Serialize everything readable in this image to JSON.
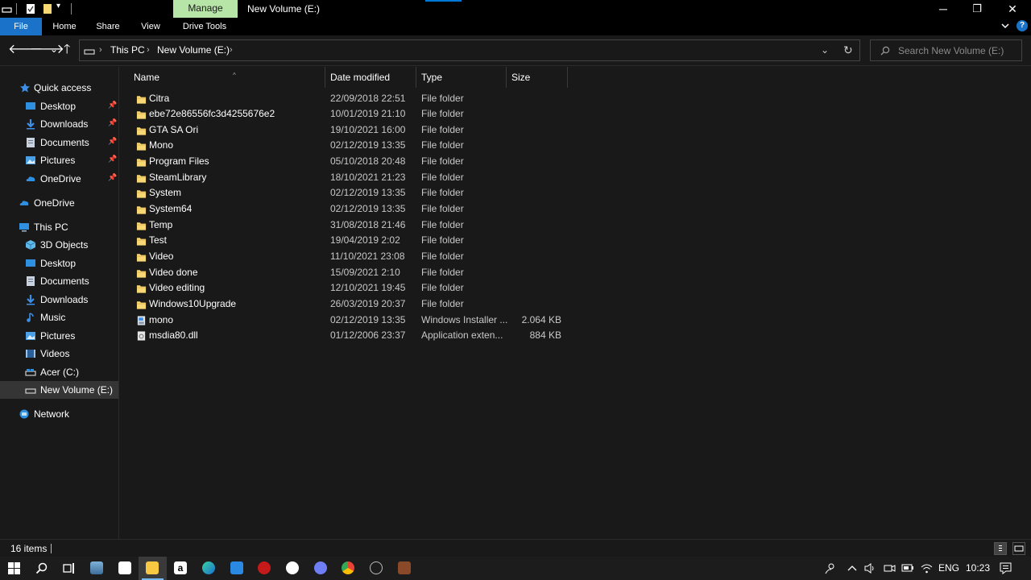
{
  "window": {
    "title": "New Volume (E:)",
    "context_tab": "Manage",
    "controls": {
      "minimize": "─",
      "restore": "❐",
      "close": "✕"
    }
  },
  "ribbon": {
    "tabs": [
      "File",
      "Home",
      "Share",
      "View",
      "Drive Tools"
    ],
    "collapse_icon": "chevron-down-icon",
    "help": "?"
  },
  "nav": {
    "back": "🡐",
    "forward": "🡒",
    "recent": "⌄",
    "up": "🡑",
    "breadcrumb": [
      "This PC",
      "New Volume (E:)"
    ],
    "refresh": "↻",
    "dropdown": "⌄"
  },
  "search": {
    "placeholder": "Search New Volume (E:)"
  },
  "sidebar": {
    "quick_access": {
      "label": "Quick access",
      "items": [
        {
          "label": "Desktop",
          "icon": "desktop-icon",
          "pinned": true
        },
        {
          "label": "Downloads",
          "icon": "download-icon",
          "pinned": true
        },
        {
          "label": "Documents",
          "icon": "documents-icon",
          "pinned": true
        },
        {
          "label": "Pictures",
          "icon": "pictures-icon",
          "pinned": true
        },
        {
          "label": "OneDrive",
          "icon": "onedrive-icon",
          "pinned": true
        }
      ]
    },
    "onedrive": {
      "label": "OneDrive"
    },
    "this_pc": {
      "label": "This PC",
      "items": [
        {
          "label": "3D Objects",
          "icon": "3d-objects-icon"
        },
        {
          "label": "Desktop",
          "icon": "desktop-icon"
        },
        {
          "label": "Documents",
          "icon": "documents-icon"
        },
        {
          "label": "Downloads",
          "icon": "download-icon"
        },
        {
          "label": "Music",
          "icon": "music-icon"
        },
        {
          "label": "Pictures",
          "icon": "pictures-icon"
        },
        {
          "label": "Videos",
          "icon": "videos-icon"
        },
        {
          "label": "Acer (C:)",
          "icon": "drive-icon"
        },
        {
          "label": "New Volume (E:)",
          "icon": "drive-icon",
          "selected": true
        }
      ]
    },
    "network": {
      "label": "Network"
    },
    "pin_glyph": "📌"
  },
  "columns": {
    "name": "Name",
    "date": "Date modified",
    "type": "Type",
    "size": "Size"
  },
  "files": [
    {
      "name": "Citra",
      "date": "22/09/2018 22:51",
      "type": "File folder",
      "size": "",
      "icon": "folder-icon"
    },
    {
      "name": "ebe72e86556fc3d4255676e2",
      "date": "10/01/2019 21:10",
      "type": "File folder",
      "size": "",
      "icon": "folder-icon"
    },
    {
      "name": "GTA SA Ori",
      "date": "19/10/2021 16:00",
      "type": "File folder",
      "size": "",
      "icon": "folder-icon"
    },
    {
      "name": "Mono",
      "date": "02/12/2019 13:35",
      "type": "File folder",
      "size": "",
      "icon": "folder-icon"
    },
    {
      "name": "Program Files",
      "date": "05/10/2018 20:48",
      "type": "File folder",
      "size": "",
      "icon": "folder-icon"
    },
    {
      "name": "SteamLibrary",
      "date": "18/10/2021 21:23",
      "type": "File folder",
      "size": "",
      "icon": "folder-icon"
    },
    {
      "name": "System",
      "date": "02/12/2019 13:35",
      "type": "File folder",
      "size": "",
      "icon": "folder-icon"
    },
    {
      "name": "System64",
      "date": "02/12/2019 13:35",
      "type": "File folder",
      "size": "",
      "icon": "folder-icon"
    },
    {
      "name": "Temp",
      "date": "31/08/2018 21:46",
      "type": "File folder",
      "size": "",
      "icon": "folder-icon"
    },
    {
      "name": "Test",
      "date": "19/04/2019 2:02",
      "type": "File folder",
      "size": "",
      "icon": "folder-icon"
    },
    {
      "name": "Video",
      "date": "11/10/2021 23:08",
      "type": "File folder",
      "size": "",
      "icon": "folder-icon"
    },
    {
      "name": "Video done",
      "date": "15/09/2021 2:10",
      "type": "File folder",
      "size": "",
      "icon": "folder-icon"
    },
    {
      "name": "Video editing",
      "date": "12/10/2021 19:45",
      "type": "File folder",
      "size": "",
      "icon": "folder-icon"
    },
    {
      "name": "Windows10Upgrade",
      "date": "26/03/2019 20:37",
      "type": "File folder",
      "size": "",
      "icon": "folder-icon"
    },
    {
      "name": "mono",
      "date": "02/12/2019 13:35",
      "type": "Windows Installer ...",
      "size": "2.064 KB",
      "icon": "installer-icon"
    },
    {
      "name": "msdia80.dll",
      "date": "01/12/2006 23:37",
      "type": "Application exten...",
      "size": "884 KB",
      "icon": "dll-file-icon"
    }
  ],
  "status": {
    "item_count": "16 items"
  },
  "taskbar": {
    "apps": [
      "start-icon",
      "search-icon",
      "task-view-icon",
      "photos-icon",
      "store-icon",
      "file-explorer-icon",
      "amazon-icon",
      "edge-icon",
      "mail-icon",
      "power-app-icon",
      "whatsapp-icon",
      "discord-icon",
      "chrome-icon",
      "steam-icon",
      "game-icon"
    ],
    "language": "ENG",
    "time": "10:23"
  },
  "colors": {
    "accent": "#1a73c9",
    "folder": "#f8d775",
    "manage_tab": "#b7e4a7",
    "selected": "#353535"
  }
}
